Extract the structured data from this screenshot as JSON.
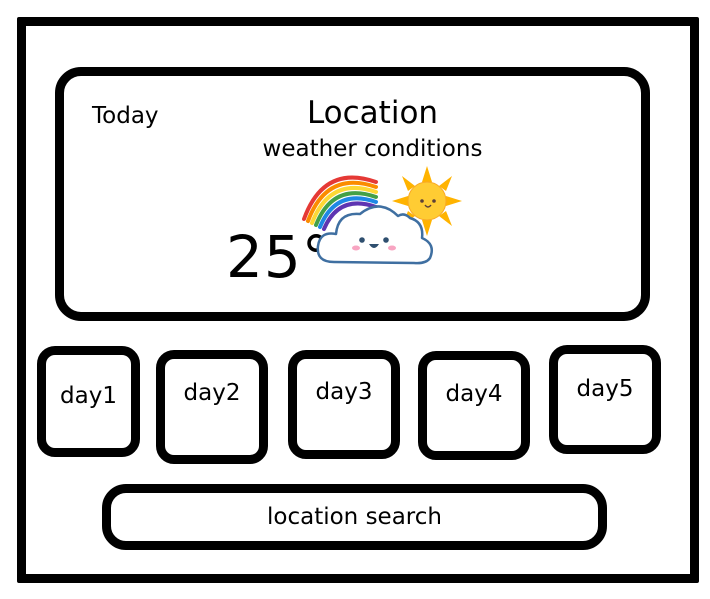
{
  "today": {
    "label": "Today",
    "location": "Location",
    "conditions": "weather conditions",
    "temperature": "25°",
    "icons": [
      "rainbow-icon",
      "smiling-cloud-icon",
      "smiling-sun-icon"
    ]
  },
  "forecast": {
    "days": [
      {
        "label": "day1"
      },
      {
        "label": "day2"
      },
      {
        "label": "day3"
      },
      {
        "label": "day4"
      },
      {
        "label": "day5"
      }
    ]
  },
  "search": {
    "label": "location search"
  },
  "colors": {
    "stroke": "#000000",
    "cloud_outline": "#3f6fa1",
    "sun": "#ffc21f"
  }
}
